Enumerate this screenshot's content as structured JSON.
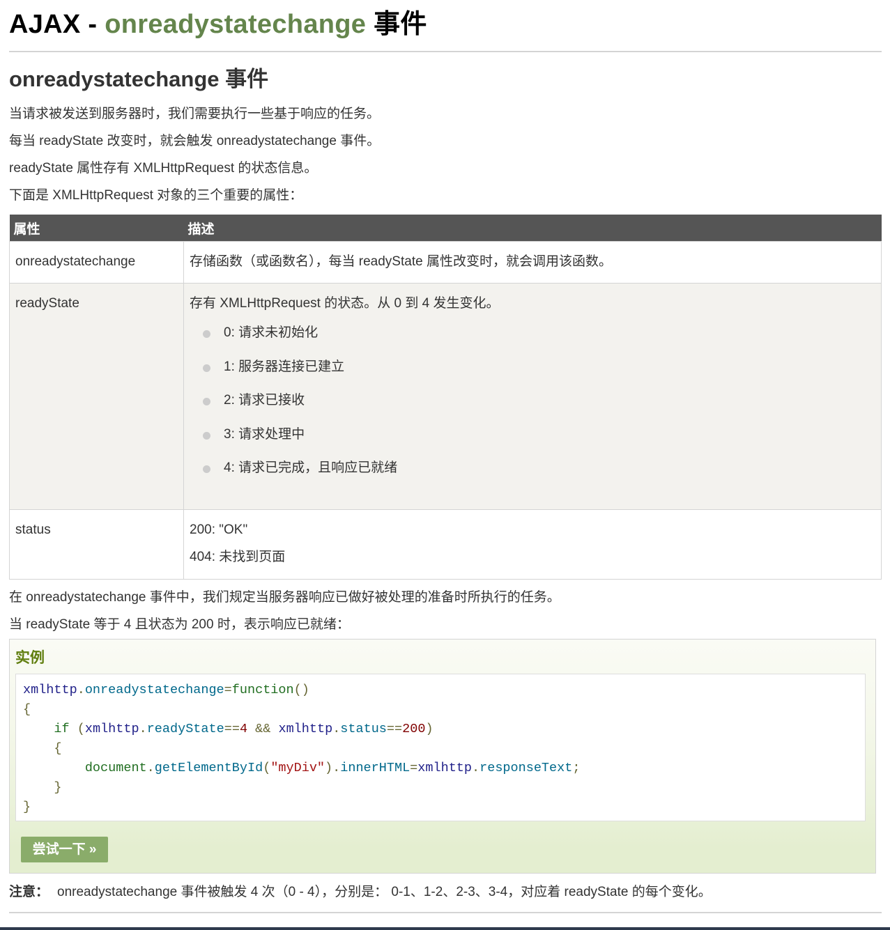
{
  "title": {
    "prefix": "AJAX - ",
    "highlight": "onreadystatechange",
    "suffix": " 事件"
  },
  "section_heading": "onreadystatechange 事件",
  "intro": [
    "当请求被发送到服务器时，我们需要执行一些基于响应的任务。",
    "每当 readyState 改变时，就会触发 onreadystatechange 事件。",
    "readyState 属性存有 XMLHttpRequest 的状态信息。",
    "下面是 XMLHttpRequest 对象的三个重要的属性："
  ],
  "table": {
    "headers": [
      "属性",
      "描述"
    ],
    "rows": [
      {
        "property": "onreadystatechange",
        "description": "存储函数（或函数名），每当 readyState 属性改变时，就会调用该函数。"
      },
      {
        "property": "readyState",
        "description": "存有 XMLHttpRequest 的状态。从 0 到 4 发生变化。",
        "states": [
          "0: 请求未初始化",
          "1: 服务器连接已建立",
          "2: 请求已接收",
          "3: 请求处理中",
          "4: 请求已完成，且响应已就绪"
        ]
      },
      {
        "property": "status",
        "lines": [
          "200: \"OK\"",
          "404: 未找到页面"
        ]
      }
    ]
  },
  "after_table": [
    "在 onreadystatechange 事件中，我们规定当服务器响应已做好被处理的准备时所执行的任务。",
    "当 readyState 等于 4 且状态为 200 时，表示响应已就绪："
  ],
  "example": {
    "heading": "实例",
    "code": {
      "l1": {
        "obj": "xmlhttp",
        "dot": ".",
        "prop": "onreadystatechange",
        "eq": "=",
        "kw": "function",
        "paren": "()"
      },
      "l2": "{",
      "l3": {
        "indent": "    ",
        "kw": "if",
        "open": " (",
        "obj1": "xmlhttp",
        "dot1": ".",
        "prop1": "readyState",
        "eq1": "==",
        "num1": "4",
        "and": " && ",
        "obj2": "xmlhttp",
        "dot2": ".",
        "prop2": "status",
        "eq2": "==",
        "num2": "200",
        "close": ")"
      },
      "l4": "    {",
      "l5": {
        "indent": "        ",
        "obj": "document",
        "dot1": ".",
        "fn": "getElementById",
        "open": "(",
        "str": "\"myDiv\"",
        "close": ")",
        "dot2": ".",
        "prop": "innerHTML",
        "eq": "=",
        "obj2": "xmlhttp",
        "dot3": ".",
        "prop2": "responseText",
        "semi": ";"
      },
      "l6": "    }",
      "l7": "}"
    },
    "button": "尝试一下 »"
  },
  "note": {
    "label": "注意：",
    "text": "onreadystatechange 事件被触发 4 次（0 - 4），分别是： 0-1、1-2、2-3、3-4，对应着 readyState 的每个变化。"
  }
}
